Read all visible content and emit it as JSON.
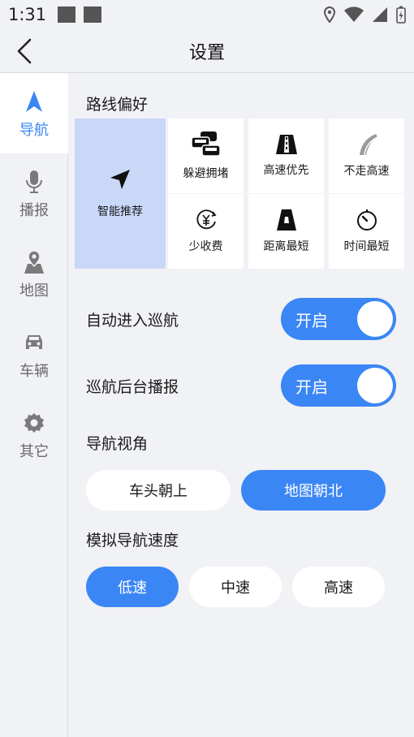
{
  "status_bar": {
    "time": "1:31"
  },
  "header": {
    "title": "设置"
  },
  "sidebar": {
    "items": [
      {
        "label": "导航",
        "icon": "navigation-arrow-icon",
        "active": true
      },
      {
        "label": "播报",
        "icon": "microphone-icon",
        "active": false
      },
      {
        "label": "地图",
        "icon": "map-pin-icon",
        "active": false
      },
      {
        "label": "车辆",
        "icon": "car-icon",
        "active": false
      },
      {
        "label": "其它",
        "icon": "gear-icon",
        "active": false
      }
    ]
  },
  "route_preference": {
    "label": "路线偏好",
    "smart": {
      "label": "智能推荐",
      "icon": "navigation-cursor-icon",
      "selected": true
    },
    "options": [
      {
        "label": "躲避拥堵",
        "icon": "traffic-jam-icon"
      },
      {
        "label": "高速优先",
        "icon": "highway-icon"
      },
      {
        "label": "不走高速",
        "icon": "no-highway-icon"
      },
      {
        "label": "少收费",
        "icon": "yuan-coin-icon"
      },
      {
        "label": "距离最短",
        "icon": "short-road-icon"
      },
      {
        "label": "时间最短",
        "icon": "timer-icon"
      }
    ]
  },
  "auto_cruise": {
    "label": "自动进入巡航",
    "state_label": "开启",
    "on": true
  },
  "cruise_broadcast": {
    "label": "巡航后台播报",
    "state_label": "开启",
    "on": true
  },
  "nav_view": {
    "label": "导航视角",
    "options": [
      {
        "label": "车头朝上",
        "selected": false
      },
      {
        "label": "地图朝北",
        "selected": true
      }
    ]
  },
  "sim_speed": {
    "label": "模拟导航速度",
    "options": [
      {
        "label": "低速",
        "selected": true
      },
      {
        "label": "中速",
        "selected": false
      },
      {
        "label": "高速",
        "selected": false
      }
    ]
  },
  "colors": {
    "accent": "#3b86f5",
    "smart_bg": "#c9d8f7",
    "background": "#f1f2f5"
  }
}
